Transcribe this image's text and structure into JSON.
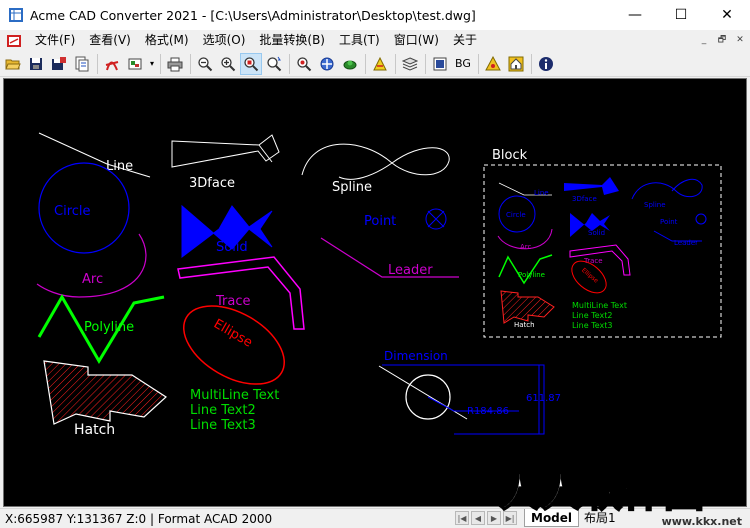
{
  "window": {
    "title": "Acme CAD Converter 2021 - [C:\\Users\\Administrator\\Desktop\\test.dwg]",
    "minimize": "—",
    "maximize": "☐",
    "close": "✕"
  },
  "menu": {
    "items": [
      "文件(F)",
      "查看(V)",
      "格式(M)",
      "选项(O)",
      "批量转换(B)",
      "工具(T)",
      "窗口(W)",
      "关于"
    ],
    "mdi_minimize": "_",
    "mdi_restore": "🗗",
    "mdi_close": "✕"
  },
  "toolbar": {
    "bg_label": "BG",
    "dropdown_glyph": "▾"
  },
  "drawing": {
    "line": "Line",
    "face3d": "3Dface",
    "spline": "Spline",
    "block_title": "Block",
    "circle": "Circle",
    "solid": "Solid",
    "point": "Point",
    "arc": "Arc",
    "leader": "Leader",
    "trace": "Trace",
    "polyline": "Polyline",
    "ellipse": "Ellipse",
    "dimension": "Dimension",
    "hatch": "Hatch",
    "mtext1": "MultiLine Text",
    "mtext2": "Line Text2",
    "mtext3": "Line Text3",
    "dim_r": "R184.86",
    "dim_h": "611.87",
    "block_line": "Line",
    "block_3dface": "3Dface",
    "block_spline": "Spline",
    "block_circle": "Circle",
    "block_solid": "Solid",
    "block_point": "Point",
    "block_trace": "Trace",
    "block_arc": "Arc",
    "block_leader": "Leader",
    "block_polyline": "Polyline",
    "block_ellipse": "Ellipse",
    "block_mtext1": "MultiLine Text",
    "block_mtext2": "Line Text2",
    "block_mtext3": "Line Text3",
    "block_hatch": "Hatch"
  },
  "status": {
    "text": "X:665987 Y:131367 Z:0 | Format ACAD 2000",
    "nav_first": "|◀",
    "nav_prev": "◀",
    "nav_next": "▶",
    "nav_last": "▶|",
    "tab_model": "Model",
    "tab_layout1": "布局1"
  },
  "watermark": {
    "text": "人人软件园",
    "url": "www.kkx.net"
  },
  "colors": {
    "canvas_bg": "#000000",
    "white": "#ffffff",
    "blue": "#0000ff",
    "magenta": "#ff00ff",
    "green": "#00ff00",
    "red": "#ff0000",
    "selection": "#cce4f7"
  }
}
